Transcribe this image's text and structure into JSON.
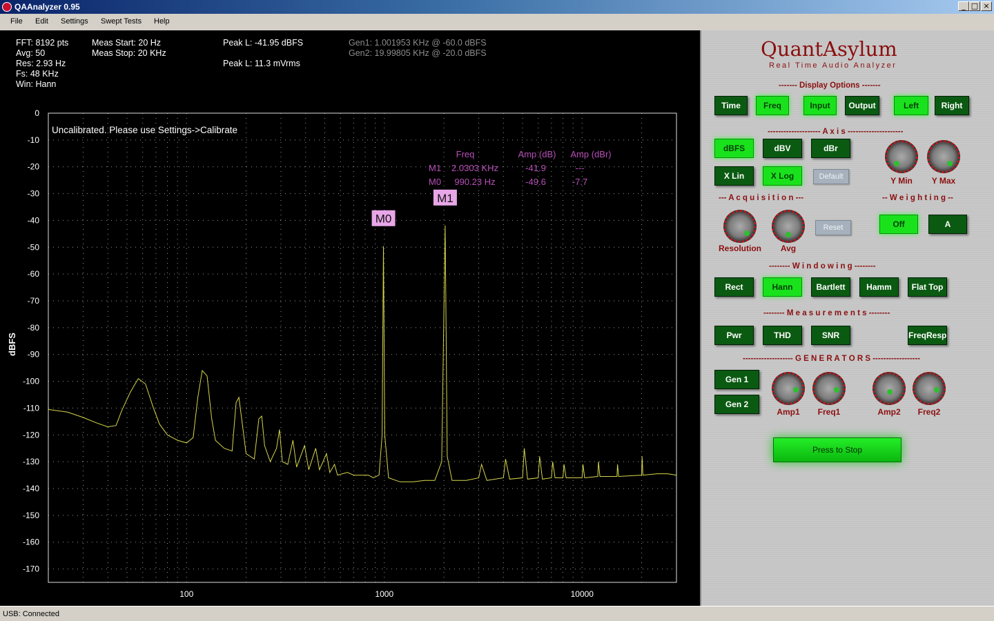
{
  "window": {
    "title": "QAAnalyzer 0.95",
    "min_glyph": "_",
    "max_glyph": "□",
    "close_glyph": "×"
  },
  "menu": [
    "File",
    "Edit",
    "Settings",
    "Swept Tests",
    "Help"
  ],
  "stats": {
    "fft": "FFT: 8192 pts",
    "avg": "Avg: 50",
    "res": "Res: 2.93 Hz",
    "fs": "Fs: 48 KHz",
    "win": "Win: Hann",
    "meas_start": "Meas Start: 20 Hz",
    "meas_stop": "Meas Stop: 20 KHz",
    "peak_dbfs": "Peak L: -41.95 dBFS",
    "peak_vrms": "Peak L: 11.3 mVrms",
    "gen1": "Gen1: 1.001953 KHz @ -60.0 dBFS",
    "gen2": "Gen2: 19.99805 KHz @ -20.0 dBFS"
  },
  "chart_data": {
    "type": "line",
    "ylabel": "dBFS",
    "x_scale": "log",
    "xlim": [
      20,
      30000
    ],
    "ylim": [
      -175,
      0
    ],
    "y_ticks": [
      0,
      -10,
      -20,
      -30,
      -40,
      -50,
      -60,
      -70,
      -80,
      -90,
      -100,
      -110,
      -120,
      -130,
      -140,
      -150,
      -160,
      -170
    ],
    "x_tick_labels": [
      {
        "value": 100,
        "label": "100"
      },
      {
        "value": 1000,
        "label": "1000"
      },
      {
        "value": 10000,
        "label": "10000"
      }
    ],
    "grid": true,
    "annotation": "Uncalibrated. Please use Settings->Calibrate",
    "marker_table": {
      "headers": [
        "Freq",
        "Amp (dB)",
        "Amp (dBr)"
      ],
      "rows": [
        {
          "name": "M1",
          "freq": "2.0303 KHz",
          "amp_db": "-41.9",
          "amp_dbr": "---"
        },
        {
          "name": "M0",
          "freq": "990.23 Hz",
          "amp_db": "-49.6",
          "amp_dbr": "-7.7"
        }
      ]
    },
    "markers": [
      {
        "label": "M0",
        "x": 990.23,
        "y": -49.6
      },
      {
        "label": "M1",
        "x": 2030.3,
        "y": -41.9
      }
    ],
    "series": [
      {
        "color": "#d7d74a",
        "points": [
          [
            20,
            -110.5
          ],
          [
            25,
            -111.5
          ],
          [
            30,
            -113.5
          ],
          [
            35,
            -115.5
          ],
          [
            40,
            -117
          ],
          [
            44,
            -116.5
          ],
          [
            47,
            -111
          ],
          [
            52,
            -104
          ],
          [
            57,
            -99
          ],
          [
            62,
            -101
          ],
          [
            68,
            -110
          ],
          [
            73,
            -116
          ],
          [
            80,
            -120
          ],
          [
            90,
            -122
          ],
          [
            100,
            -123
          ],
          [
            108,
            -121
          ],
          [
            114,
            -106
          ],
          [
            120,
            -96
          ],
          [
            127,
            -98
          ],
          [
            134,
            -114
          ],
          [
            140,
            -122
          ],
          [
            155,
            -125
          ],
          [
            170,
            -126
          ],
          [
            178,
            -108
          ],
          [
            184,
            -106
          ],
          [
            190,
            -114
          ],
          [
            200,
            -127
          ],
          [
            220,
            -129
          ],
          [
            232,
            -114
          ],
          [
            240,
            -113
          ],
          [
            248,
            -124
          ],
          [
            265,
            -130
          ],
          [
            285,
            -125
          ],
          [
            295,
            -118
          ],
          [
            305,
            -130
          ],
          [
            325,
            -131
          ],
          [
            345,
            -122
          ],
          [
            360,
            -132
          ],
          [
            395,
            -124
          ],
          [
            415,
            -133
          ],
          [
            450,
            -125
          ],
          [
            470,
            -133
          ],
          [
            510,
            -127
          ],
          [
            530,
            -134
          ],
          [
            560,
            -131
          ],
          [
            580,
            -135
          ],
          [
            650,
            -134
          ],
          [
            700,
            -135
          ],
          [
            760,
            -135
          ],
          [
            830,
            -135
          ],
          [
            880,
            -136
          ],
          [
            940,
            -135
          ],
          [
            975,
            -120
          ],
          [
            990,
            -49.6
          ],
          [
            1005,
            -120
          ],
          [
            1050,
            -136
          ],
          [
            1200,
            -137.5
          ],
          [
            1400,
            -137.5
          ],
          [
            1600,
            -137
          ],
          [
            1800,
            -137
          ],
          [
            1950,
            -130
          ],
          [
            2030,
            -41.9
          ],
          [
            2080,
            -128
          ],
          [
            2200,
            -137
          ],
          [
            2600,
            -137
          ],
          [
            3000,
            -136
          ],
          [
            3100,
            -131
          ],
          [
            3300,
            -137
          ],
          [
            4000,
            -136
          ],
          [
            4100,
            -129
          ],
          [
            4300,
            -136.5
          ],
          [
            5000,
            -136
          ],
          [
            5100,
            -125
          ],
          [
            5300,
            -136.5
          ],
          [
            6000,
            -136
          ],
          [
            6100,
            -128
          ],
          [
            6300,
            -136.5
          ],
          [
            7000,
            -136
          ],
          [
            7100,
            -130
          ],
          [
            7300,
            -136
          ],
          [
            8000,
            -136
          ],
          [
            8100,
            -131
          ],
          [
            8300,
            -136
          ],
          [
            10000,
            -136
          ],
          [
            10100,
            -131
          ],
          [
            10300,
            -136
          ],
          [
            12000,
            -135.5
          ],
          [
            12100,
            -130
          ],
          [
            12300,
            -135.5
          ],
          [
            15000,
            -135.5
          ],
          [
            15100,
            -131
          ],
          [
            15300,
            -135.5
          ],
          [
            20000,
            -135
          ],
          [
            20100,
            -128
          ],
          [
            20300,
            -135
          ],
          [
            24000,
            -134.5
          ],
          [
            27000,
            -134.5
          ],
          [
            30000,
            -135
          ]
        ]
      }
    ]
  },
  "brand": {
    "name": "QuantAsylum",
    "tagline": "Real Time Audio Analyzer"
  },
  "sections": {
    "display": "------- Display Options -------",
    "axis": "-------------------- A x i s ---------------------",
    "acquisition": "--- A c q u i s i t i o n ---",
    "weighting": "-- W e i g h t i n g --",
    "windowing": "-------- W i n d o w i n g --------",
    "measurements": "-------- M e a s u r e m e n t s --------",
    "generators": "------------------- G E N E R A T O R S ------------------"
  },
  "buttons": {
    "time": "Time",
    "freq": "Freq",
    "input": "Input",
    "output": "Output",
    "left": "Left",
    "right": "Right",
    "dbfs": "dBFS",
    "dbv": "dBV",
    "dbr": "dBr",
    "xlin": "X Lin",
    "xlog": "X Log",
    "default": "Default",
    "reset": "Reset",
    "off": "Off",
    "a": "A",
    "rect": "Rect",
    "hann": "Hann",
    "bartlett": "Bartlett",
    "hamm": "Hamm",
    "flattop": "Flat Top",
    "pwr": "Pwr",
    "thd": "THD",
    "snr": "SNR",
    "freqresp": "FreqResp",
    "gen1": "Gen 1",
    "gen2": "Gen 2",
    "stop": "Press to Stop"
  },
  "knobs": {
    "ymin": "Y Min",
    "ymax": "Y Max",
    "resolution": "Resolution",
    "avg": "Avg",
    "amp1": "Amp1",
    "freq1": "Freq1",
    "amp2": "Amp2",
    "freq2": "Freq2"
  },
  "status": {
    "text": "USB: Connected"
  }
}
